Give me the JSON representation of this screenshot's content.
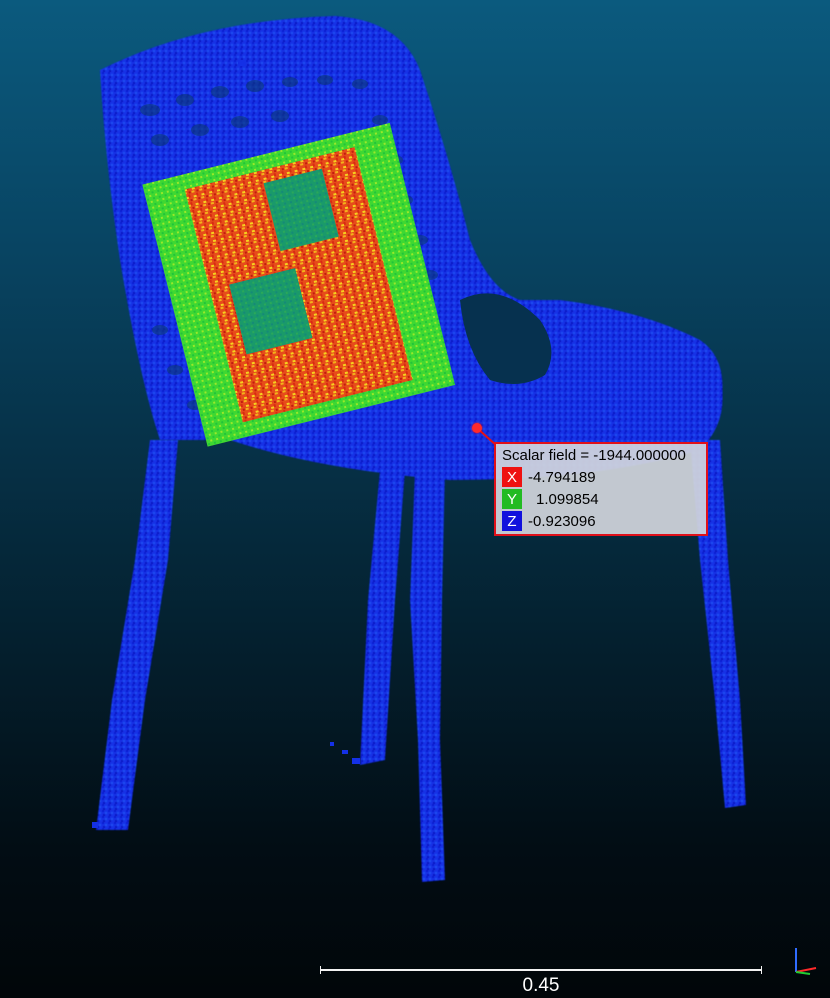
{
  "colors": {
    "background_top": "#0b5a7e",
    "background_bottom": "#010609",
    "cloud_low": "#1126e0",
    "cloud_mid": "#2fd52b",
    "cloud_high": "#e8401a",
    "label_border": "#e0101a"
  },
  "point_label": {
    "title": "Scalar field = -1944.000000",
    "coords": [
      {
        "axis": "X",
        "value": "-4.794189",
        "color": "#ee1111"
      },
      {
        "axis": "Y",
        "value": "1.099854",
        "color": "#22bb22"
      },
      {
        "axis": "Z",
        "value": "-0.923096",
        "color": "#1111dd"
      }
    ]
  },
  "scale": {
    "label": "0.45"
  },
  "icons": {
    "axis_gizmo": "xyz-trihedron-icon",
    "picked_point": "picked-point-marker"
  }
}
